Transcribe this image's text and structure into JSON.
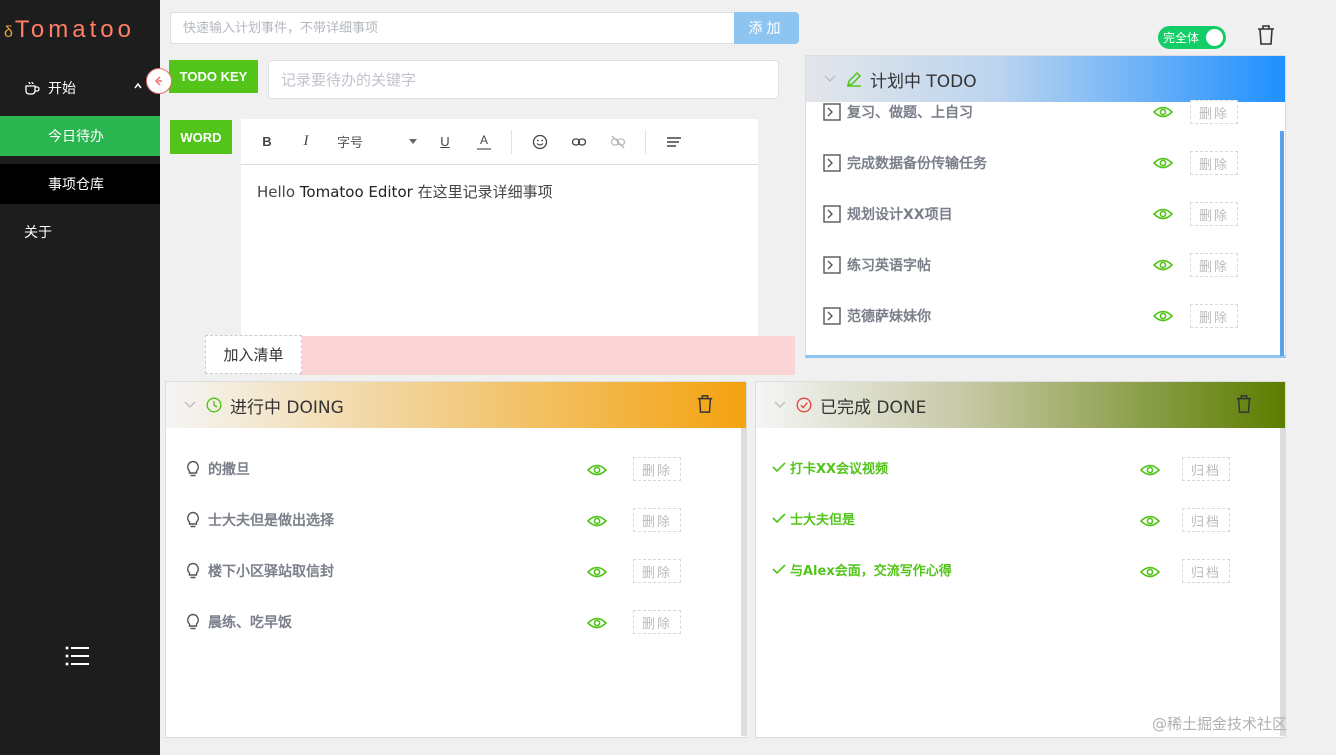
{
  "app": {
    "logo_prefix": "δ",
    "logo": "Tomatoo"
  },
  "sidebar": {
    "start_label": "开始",
    "sub_items": [
      "今日待办",
      "事项仓库"
    ],
    "about_label": "关于"
  },
  "quick": {
    "placeholder": "快速输入计划事件，不带详细事项",
    "add_label": "添加"
  },
  "todo_key": {
    "tag": "TODO KEY",
    "placeholder": "记录要待办的关键字"
  },
  "word": {
    "tag": "WORD"
  },
  "editor": {
    "toolbar": {
      "bold": "B",
      "italic": "I",
      "font_size": "字号",
      "underline": "U",
      "color": "A"
    },
    "content_prefix": "Hello ",
    "content_brand": "Tomatoo Editor",
    "content_suffix": " 在这里记录详细事项"
  },
  "add_list_label": "加入清单",
  "toggle_label": "完全体",
  "todo_panel": {
    "title": "计划中 TODO",
    "items": [
      "复习、做题、上自习",
      "完成数据备份传输任务",
      "规划设计XX项目",
      "练习英语字帖",
      "范德萨妹妹你"
    ],
    "button": "删除"
  },
  "doing_panel": {
    "title": "进行中 DOING",
    "items": [
      "的撒旦",
      "士大夫但是做出选择",
      "楼下小区驿站取信封",
      "晨练、吃早饭"
    ],
    "button": "删除"
  },
  "done_panel": {
    "title": "已完成 DONE",
    "items": [
      "打卡XX会议视频",
      "士大夫但是",
      "与Alex会面，交流写作心得"
    ],
    "button": "归档"
  },
  "watermark": "@稀土掘金技术社区",
  "colors": {
    "green": "#52c41a",
    "sidebar_bg": "#1d1d1d",
    "active_item": "#2bb550",
    "todo_accent": "#1e90ff",
    "doing_accent": "#f4a20f",
    "done_accent": "#5b7d00"
  }
}
